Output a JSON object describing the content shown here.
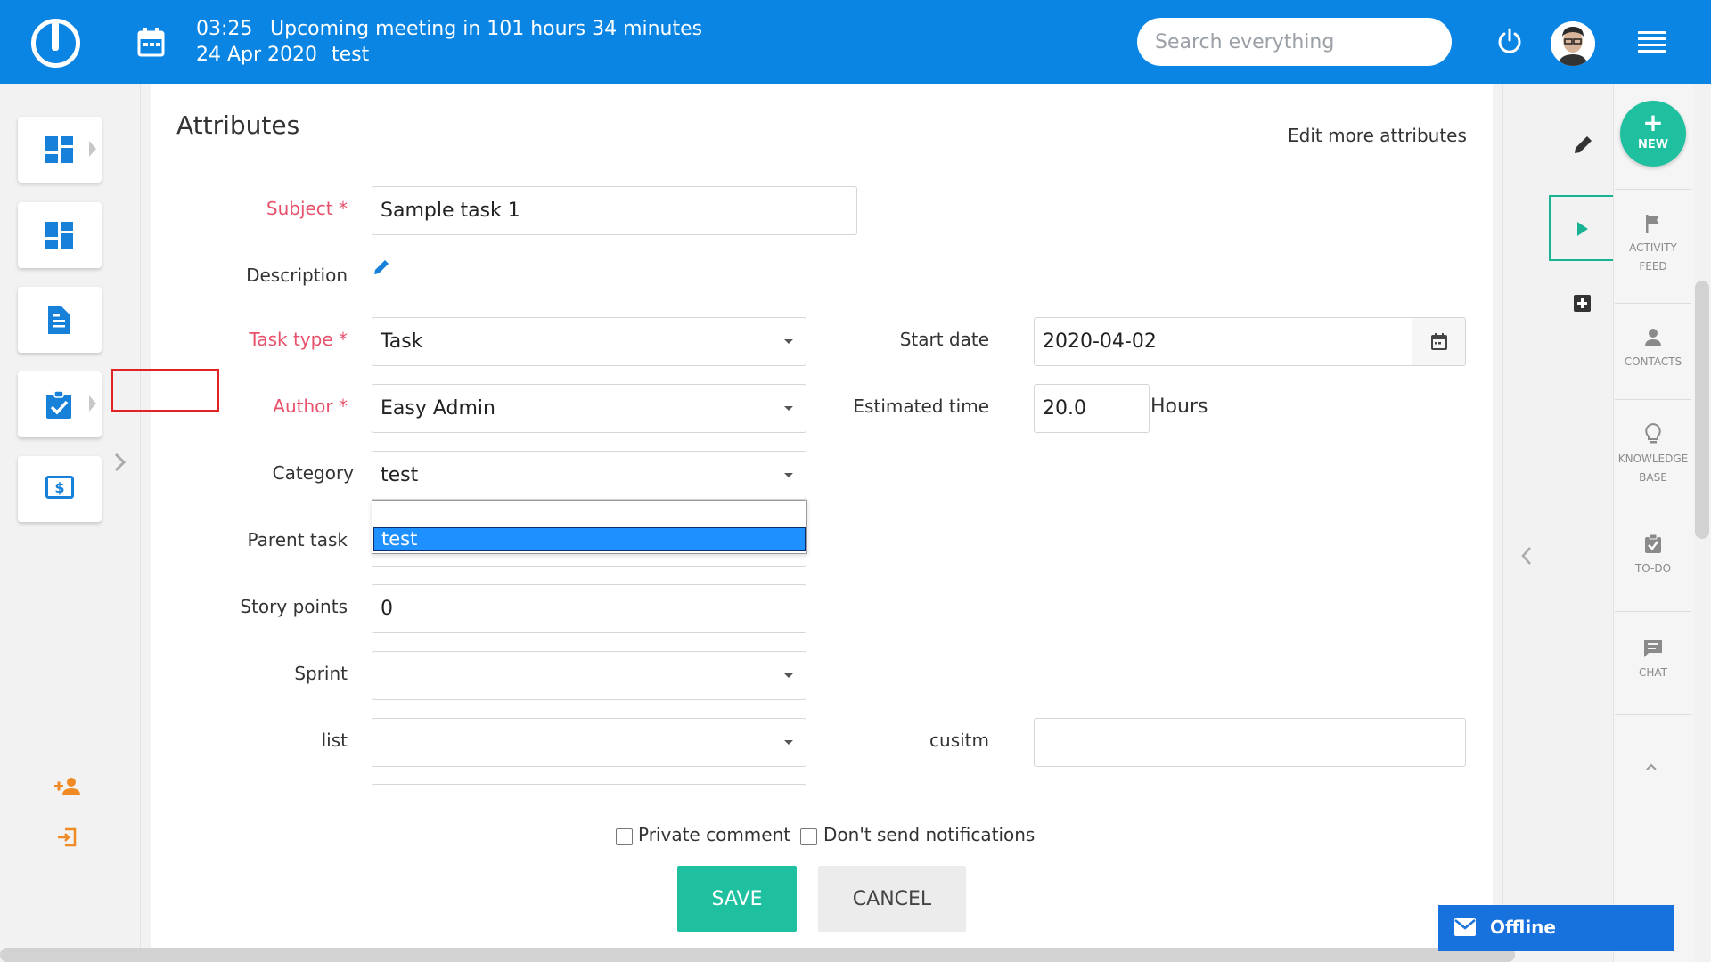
{
  "header": {
    "meeting_time": "03:25",
    "meeting_title": "Upcoming meeting in 101 hours 34 minutes",
    "meeting_date": "24 Apr 2020",
    "meeting_project": "test",
    "search_placeholder": "Search everything"
  },
  "form": {
    "title": "Attributes",
    "edit_more": "Edit more attributes",
    "labels": {
      "subject": "Subject *",
      "description": "Description",
      "task_type": "Task type *",
      "author": "Author *",
      "category": "Category",
      "parent_task": "Parent task",
      "story_points": "Story points",
      "sprint": "Sprint",
      "list": "list",
      "start_date": "Start date",
      "estimated_time": "Estimated time",
      "cusitm": "cusitm"
    },
    "values": {
      "subject": "Sample task 1",
      "task_type": "Task",
      "author": "Easy Admin",
      "category": "test",
      "story_points": "0",
      "sprint": "",
      "list": "",
      "start_date": "2020-04-02",
      "estimated_time": "20.0",
      "cusitm": ""
    },
    "hours_unit": "Hours",
    "category_options": [
      "",
      "test"
    ]
  },
  "footer": {
    "private_comment": "Private comment",
    "dont_send_notifications": "Don't send notifications",
    "save": "SAVE",
    "cancel": "CANCEL"
  },
  "right_rail": {
    "new_plus": "+",
    "new_label": "NEW",
    "activity_feed_1": "ACTIVITY",
    "activity_feed_2": "FEED",
    "contacts": "CONTACTS",
    "knowledge_base_1": "KNOWLEDGE",
    "knowledge_base_2": "BASE",
    "todo": "TO-DO",
    "chat": "CHAT"
  },
  "chat_widget": {
    "status": "Offline"
  },
  "colors": {
    "header_bg": "#0a85e4",
    "accent_green": "#1ec0a0",
    "required_label": "#e8516b",
    "highlight_red": "#e02424",
    "dropdown_selected": "#1e90ff"
  }
}
